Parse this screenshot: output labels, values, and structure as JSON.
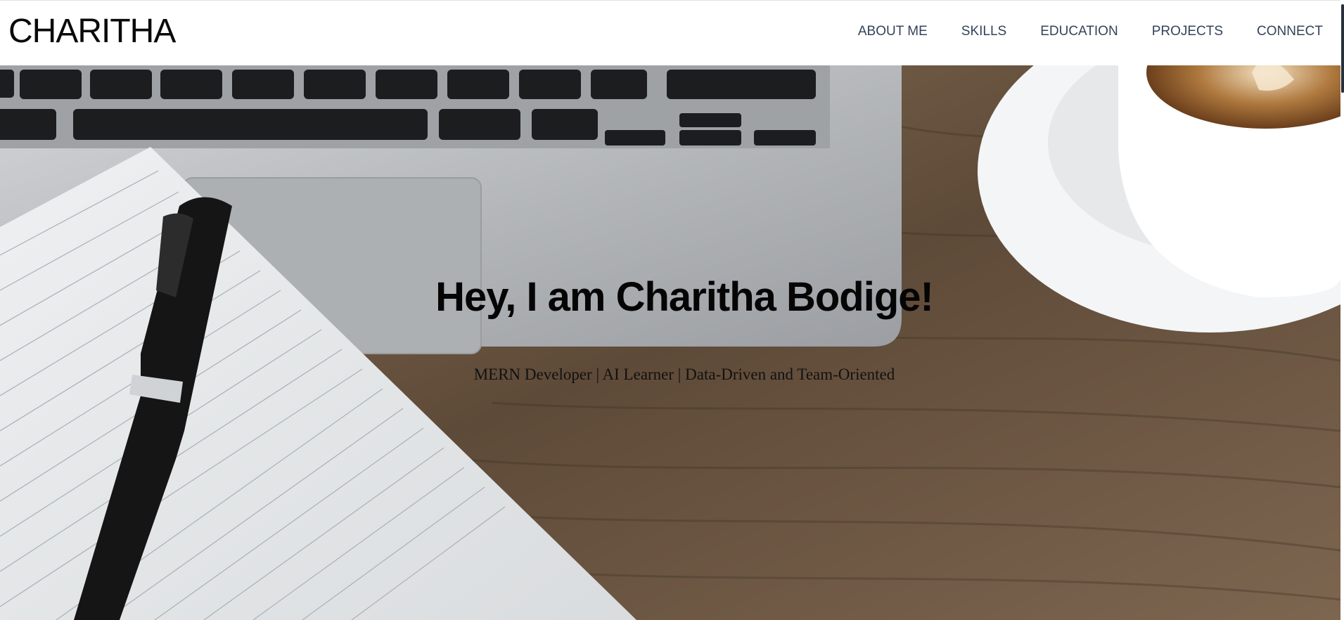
{
  "brand": {
    "name": "CHARITHA"
  },
  "nav": {
    "items": [
      {
        "label": "ABOUT ME"
      },
      {
        "label": "SKILLS"
      },
      {
        "label": "EDUCATION"
      },
      {
        "label": "PROJECTS"
      },
      {
        "label": "CONNECT"
      }
    ]
  },
  "hero": {
    "title": "Hey, I am Charitha Bodige!",
    "subtitle": "MERN Developer | AI Learner | Data-Driven and Team-Oriented"
  },
  "colors": {
    "nav_text": "#34435a",
    "brand_text": "#0a0a0a",
    "desk_wood": "#6b5744",
    "laptop_silver": "#b9bcbf"
  }
}
